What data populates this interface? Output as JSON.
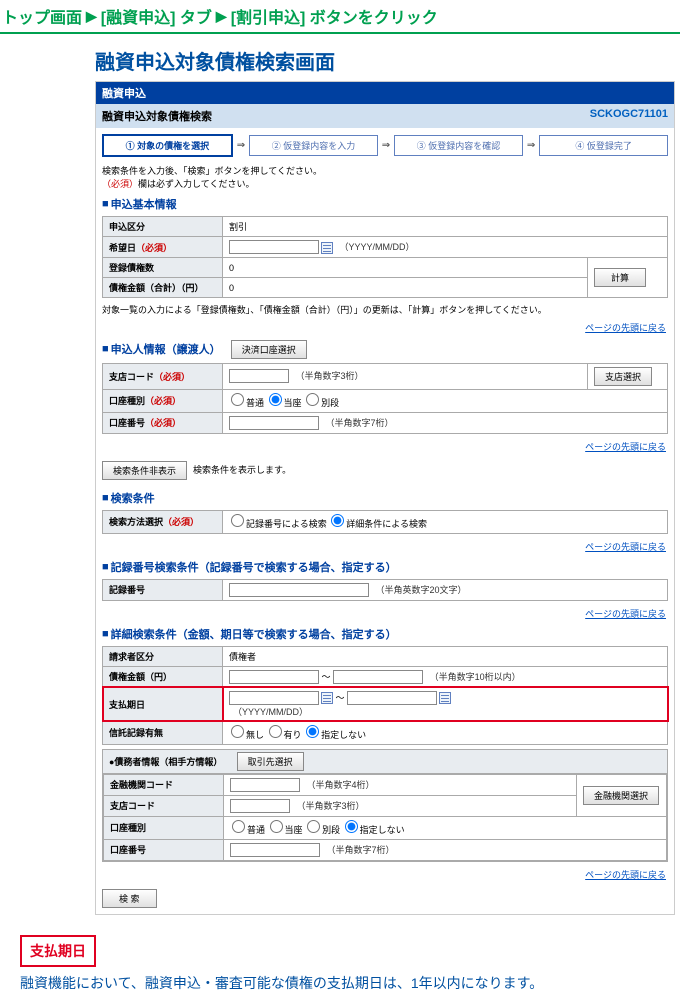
{
  "breadcrumb": {
    "part1": "トップ画面",
    "part2": "[融資申込] タブ",
    "part3": "[割引申込] ボタンをクリック"
  },
  "screen_title": "融資申込対象債権検索画面",
  "app_header": "融資申込",
  "sub_header": {
    "title": "融資申込対象債権検索",
    "screen_id": "SCKOGC71101"
  },
  "steps": {
    "s1": "① 対象の債権を選択",
    "s2": "② 仮登録内容を入力",
    "s3": "③ 仮登録内容を確認",
    "s4": "④ 仮登録完了"
  },
  "instruction": {
    "line1": "検索条件を入力後、「検索」ボタンを押してください。",
    "line2_prefix": "（必須）",
    "line2_rest": "欄は必ず入力してください。"
  },
  "sections": {
    "basic": "申込基本情報",
    "applicant": "申込人情報（譲渡人）",
    "search_cond": "検索条件",
    "record_no": "記録番号検索条件（記録番号で検索する場合、指定する）",
    "detail": "詳細検索条件（金額、期日等で検索する場合、指定する）"
  },
  "labels": {
    "app_type": "申込区分",
    "app_type_value": "割引",
    "desired_date": "希望日",
    "date_format": "（YYYY/MM/DD）",
    "reg_count": "登録債権数",
    "reg_count_value": "0",
    "total_amount": "債権金額（合計）（円）",
    "total_amount_value": "0",
    "calc_button": "計算",
    "calc_note": "対象一覧の入力による「登録債権数」、「債権金額（合計）（円）」の更新は、「計算」ボタンを押してください。",
    "settle_acct_btn": "決済口座選択",
    "branch_code": "支店コード",
    "branch_hint": "（半角数字3桁）",
    "branch_select": "支店選択",
    "acct_type": "口座種別",
    "acct_type_opts": {
      "futsuu": "普通",
      "touza": "当座",
      "betsu": "別段"
    },
    "acct_no": "口座番号",
    "acct_no_hint": "（半角数字7桁）",
    "hide_cond": "検索条件非表示",
    "hide_cond_note": "検索条件を表示します。",
    "search_method": "検索方法選択",
    "search_opts": {
      "by_no": "記録番号による検索",
      "by_detail": "詳細条件による検索"
    },
    "record_no_lbl": "記録番号",
    "record_no_hint": "（半角英数字20文字）",
    "billing_type": "請求者区分",
    "billing_value": "債権者",
    "amount": "債権金額（円）",
    "amount_hint": "（半角数字10桁以内）",
    "tilde": "～",
    "pay_date": "支払期日",
    "trust": "信託記録有無",
    "trust_opts": {
      "none": "無し",
      "yes": "有り",
      "na": "指定しない"
    },
    "debtor_info": "●債務者情報（相手方情報）",
    "tx_select": "取引先選択",
    "fin_code": "金融機関コード",
    "fin_code_hint": "（半角数字4桁）",
    "fin_select": "金融機関選択",
    "branch_code2": "支店コード",
    "acct_type2": "口座種別",
    "acct_type2_opts": {
      "na2": "指定しない"
    },
    "acct_no2": "口座番号",
    "search_btn": "検 索",
    "page_top": "ページの先頭に戻る",
    "required": "（必須）"
  },
  "footer": {
    "label": "支払期日",
    "text": "融資機能において、融資申込・審査可能な債権の支払期日は、1年以内になります。"
  }
}
